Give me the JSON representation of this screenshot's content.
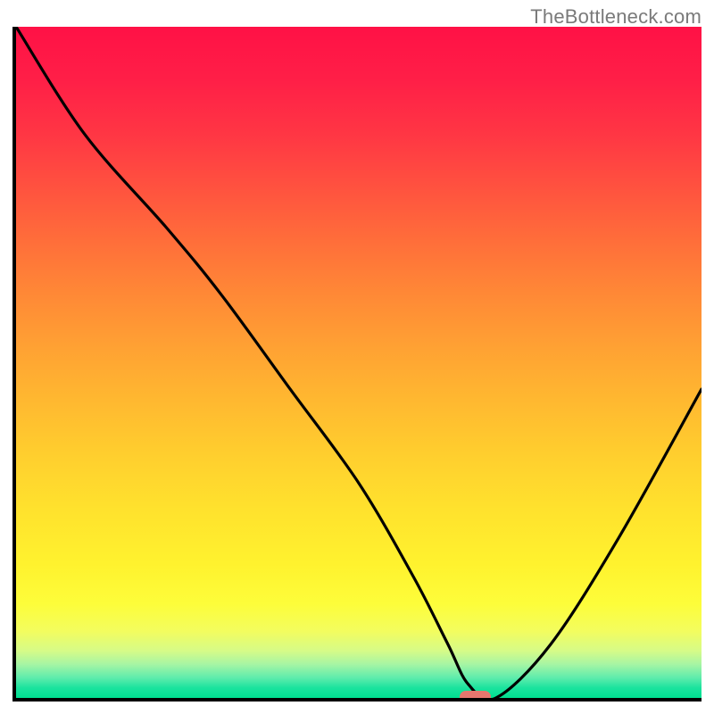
{
  "watermark": "TheBottleneck.com",
  "colors": {
    "curve": "#000000",
    "marker": "#e5766e",
    "axis": "#000000"
  },
  "chart_data": {
    "type": "line",
    "title": "",
    "xlabel": "",
    "ylabel": "",
    "xlim": [
      0,
      100
    ],
    "ylim": [
      0,
      100
    ],
    "grid": false,
    "background": "red-yellow-green vertical gradient (bottleneck heatmap)",
    "series": [
      {
        "name": "bottleneck-curve",
        "x": [
          0,
          10,
          22,
          30,
          40,
          50,
          58,
          63,
          66,
          70,
          78,
          88,
          100
        ],
        "y": [
          100,
          84,
          70,
          60,
          46,
          32,
          18,
          8,
          2,
          0,
          8,
          24,
          46
        ]
      }
    ],
    "marker": {
      "x": 67,
      "y": 0,
      "width_pct": 4.5
    },
    "annotations": []
  }
}
